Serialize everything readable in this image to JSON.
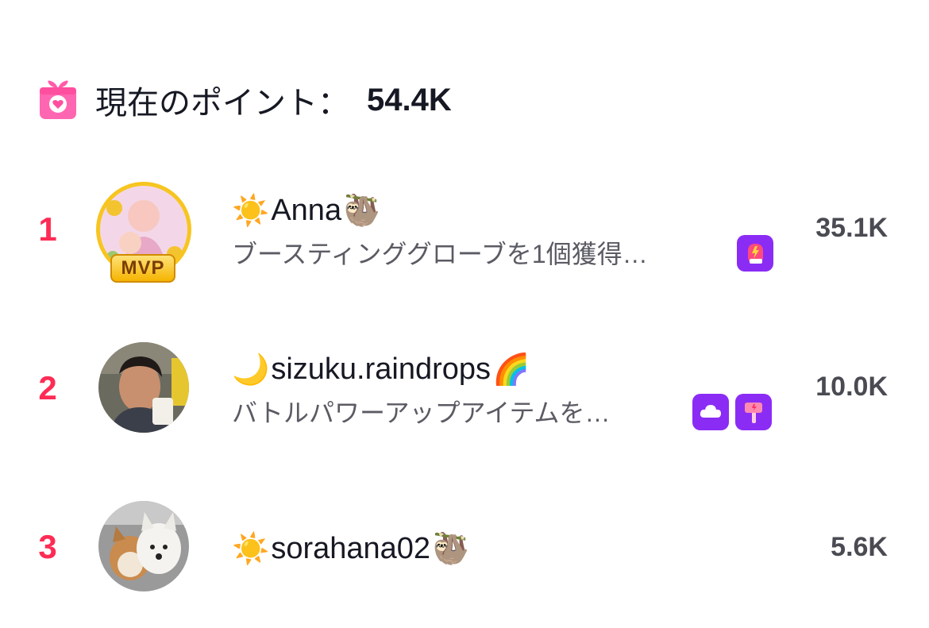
{
  "header": {
    "points_label": "現在のポイント：",
    "points_value": "54.4K"
  },
  "ranking": [
    {
      "rank": "1",
      "name_prefix": "☀️",
      "name": "Anna",
      "name_suffix": "🦥",
      "subtitle": "ブースティンググローブを1個獲得…",
      "badge": "MVP",
      "gifts": [
        "boxing-glove-icon"
      ],
      "score": "35.1K"
    },
    {
      "rank": "2",
      "name_prefix": "🌙",
      "name": "sizuku.raindrops",
      "name_suffix": "🌈",
      "subtitle": "バトルパワーアップアイテムを…",
      "gifts": [
        "cloud-icon",
        "hammer-icon"
      ],
      "score": "10.0K"
    },
    {
      "rank": "3",
      "name_prefix": "☀️",
      "name": "sorahana02",
      "name_suffix": "🦥",
      "score": "5.6K"
    }
  ],
  "colors": {
    "rank": "#fe2c55",
    "gift_badge": "#8b2cf5",
    "mvp_gold": "#f5b400"
  }
}
